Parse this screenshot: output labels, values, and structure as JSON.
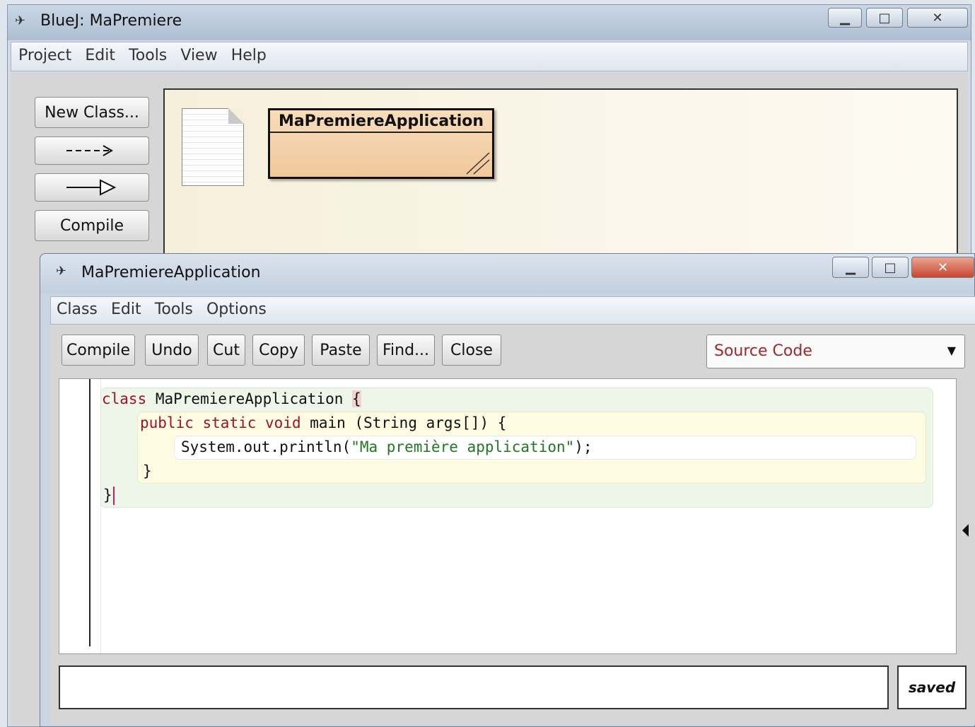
{
  "main_window": {
    "title": "BlueJ:  MaPremiere",
    "menu": [
      "Project",
      "Edit",
      "Tools",
      "View",
      "Help"
    ],
    "buttons": {
      "new_class": "New Class...",
      "dependency_arrow": "--->",
      "inheritance_arrow": "—▷",
      "compile": "Compile"
    },
    "diagram": {
      "class_name": "MaPremiereApplication"
    }
  },
  "editor_window": {
    "title": "MaPremiereApplication",
    "menu": [
      "Class",
      "Edit",
      "Tools",
      "Options"
    ],
    "toolbar": [
      "Compile",
      "Undo",
      "Cut",
      "Copy",
      "Paste",
      "Find...",
      "Close"
    ],
    "view_select": "Source Code",
    "code": {
      "line1_kw": "class",
      "line1_rest": " MaPremiereApplication ",
      "line1_brace": "{",
      "line2_kw1": "public",
      "line2_kw2": "static",
      "line2_kw3": "void",
      "line2_rest": " main (String args[]) {",
      "line3_pre": "System.out.println(",
      "line3_str": "\"Ma première application\"",
      "line3_post": ");",
      "line4": "}",
      "line5": "}"
    },
    "status": {
      "message": "",
      "saved": "saved"
    }
  },
  "colors": {
    "keyword": "#a0122a",
    "string": "#1f7a1f",
    "class_fill": "#f1c89b",
    "diagram_bg": "#f6efdb"
  }
}
